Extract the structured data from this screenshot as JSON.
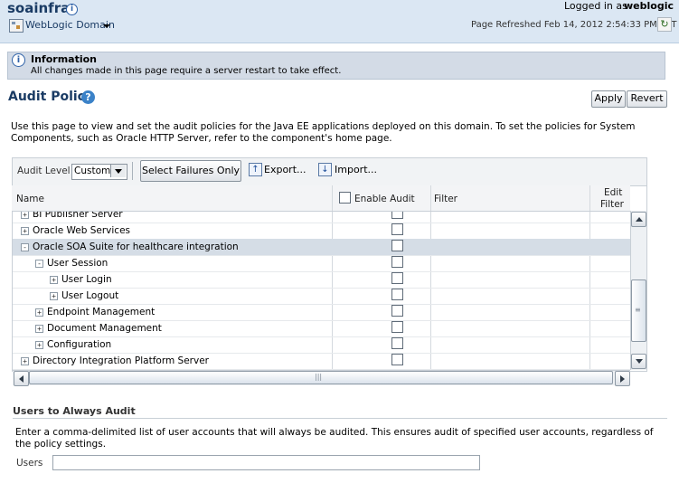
{
  "header": {
    "app_title": "soainfra",
    "domain_menu": "WebLogic Domain",
    "logged_in_label": "Logged in as",
    "user": "weblogic",
    "page_refreshed": "Page Refreshed Feb 14, 2012 2:54:33 PM PST"
  },
  "info": {
    "title": "Information",
    "message": "All changes made in this page require a server restart to take effect."
  },
  "audit_policy": {
    "title": "Audit Policy",
    "apply_label": "Apply",
    "revert_label": "Revert",
    "description": "Use this page to view and set the audit policies for the Java EE applications deployed on this domain. To set the policies for System Components, such as Oracle HTTP Server, refer to the component's home page."
  },
  "toolbar": {
    "audit_level_label": "Audit Level",
    "audit_level_value": "Custom",
    "select_failures_label": "Select Failures Only",
    "export_label": "Export...",
    "import_label": "Import..."
  },
  "table": {
    "columns": {
      "name": "Name",
      "enable_audit": "Enable Audit",
      "filter": "Filter",
      "edit_filter_line1": "Edit",
      "edit_filter_line2": "Filter"
    },
    "rows": [
      {
        "label": "BI Publisher Server",
        "toggle": "+",
        "selected": false
      },
      {
        "label": "Oracle Web Services",
        "toggle": "+",
        "selected": false
      },
      {
        "label": "Oracle SOA Suite for healthcare integration",
        "toggle": "-",
        "selected": true
      },
      {
        "label": "User Session",
        "toggle": "-",
        "selected": false
      },
      {
        "label": "User Login",
        "toggle": "+",
        "selected": false
      },
      {
        "label": "User Logout",
        "toggle": "+",
        "selected": false
      },
      {
        "label": "Endpoint Management",
        "toggle": "+",
        "selected": false
      },
      {
        "label": "Document Management",
        "toggle": "+",
        "selected": false
      },
      {
        "label": "Configuration",
        "toggle": "+",
        "selected": false
      },
      {
        "label": "Directory Integration Platform Server",
        "toggle": "+",
        "selected": false
      }
    ]
  },
  "users_section": {
    "title": "Users to Always Audit",
    "description": "Enter a comma-delimited list of user accounts that will always be audited. This ensures audit of specified user accounts, regardless of the policy settings.",
    "users_label": "Users",
    "users_value": ""
  },
  "colors": {
    "header_bg": "#dbe7f3",
    "title_blue": "#1a3b64",
    "selected_row": "#d5dde6"
  }
}
